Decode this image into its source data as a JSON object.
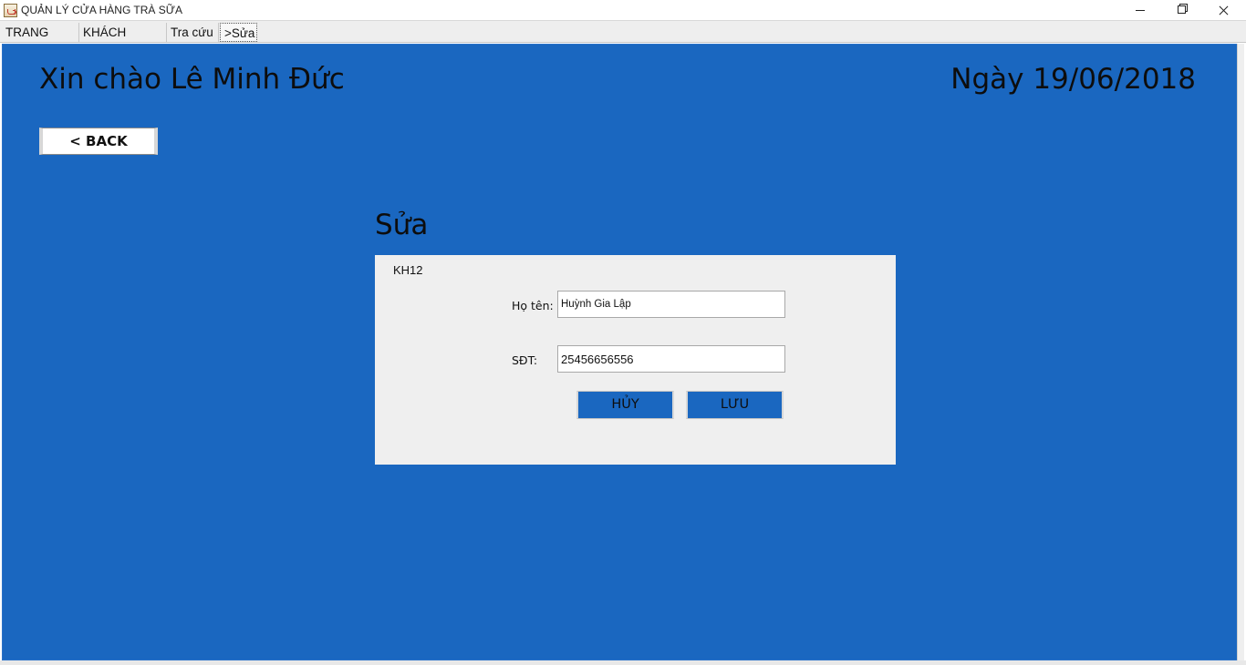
{
  "window": {
    "title": "QUẢN LÝ CỬA HÀNG TRÀ SỮA",
    "icon": "java-coffee-cup-icon",
    "controls": {
      "minimize_icon": "minimize-icon",
      "restore_icon": "restore-icon",
      "close_icon": "close-icon"
    }
  },
  "tabs": [
    {
      "label": "TRANG CHỦ",
      "active": false
    },
    {
      "label": "KHÁCH HÀNG",
      "active": false
    },
    {
      "label": "Tra cứu",
      "active": false
    },
    {
      "label": ">Sửa",
      "active": true
    }
  ],
  "header": {
    "greeting": "Xin chào Lê Minh Đức",
    "date": "Ngày 19/06/2018"
  },
  "back_button": {
    "label": "< BACK"
  },
  "edit_form": {
    "title": "Sửa",
    "customer_id": "KH12",
    "name_label": "Họ tên:",
    "name_value": "Huỳnh Gia Lập",
    "phone_label": "SĐT:",
    "phone_value": "25456656556",
    "cancel_label": "HỦY",
    "save_label": "LƯU"
  },
  "colors": {
    "panel_blue": "#1a67c0",
    "form_background": "#efefef",
    "text_dark": "#0d0d0d"
  }
}
